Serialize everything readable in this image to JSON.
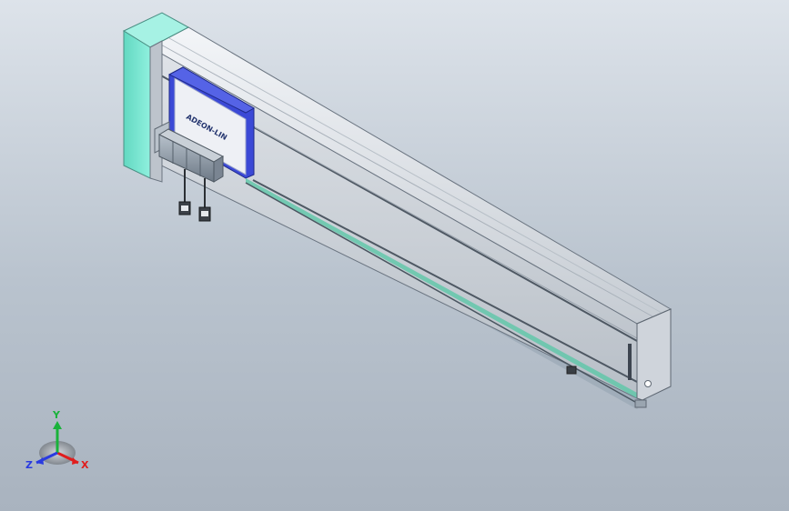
{
  "viewport": {
    "background_top": "#dde3ea",
    "background_bottom": "#a9b3bf"
  },
  "model": {
    "carriage_label": "ADEON-LIN",
    "colors": {
      "end_cap": "#7fe8d3",
      "rail_body": "#d8dde3",
      "carriage_frame": "#3b49d6",
      "carriage_face": "#eef0f5",
      "motor": "#8d9aa8"
    }
  },
  "triad": {
    "x_label": "X",
    "y_label": "Y",
    "z_label": "Z",
    "x_color": "#e01d1d",
    "y_color": "#19b23a",
    "z_color": "#2a3be0",
    "icons": [
      "axis-triad-icon"
    ]
  }
}
